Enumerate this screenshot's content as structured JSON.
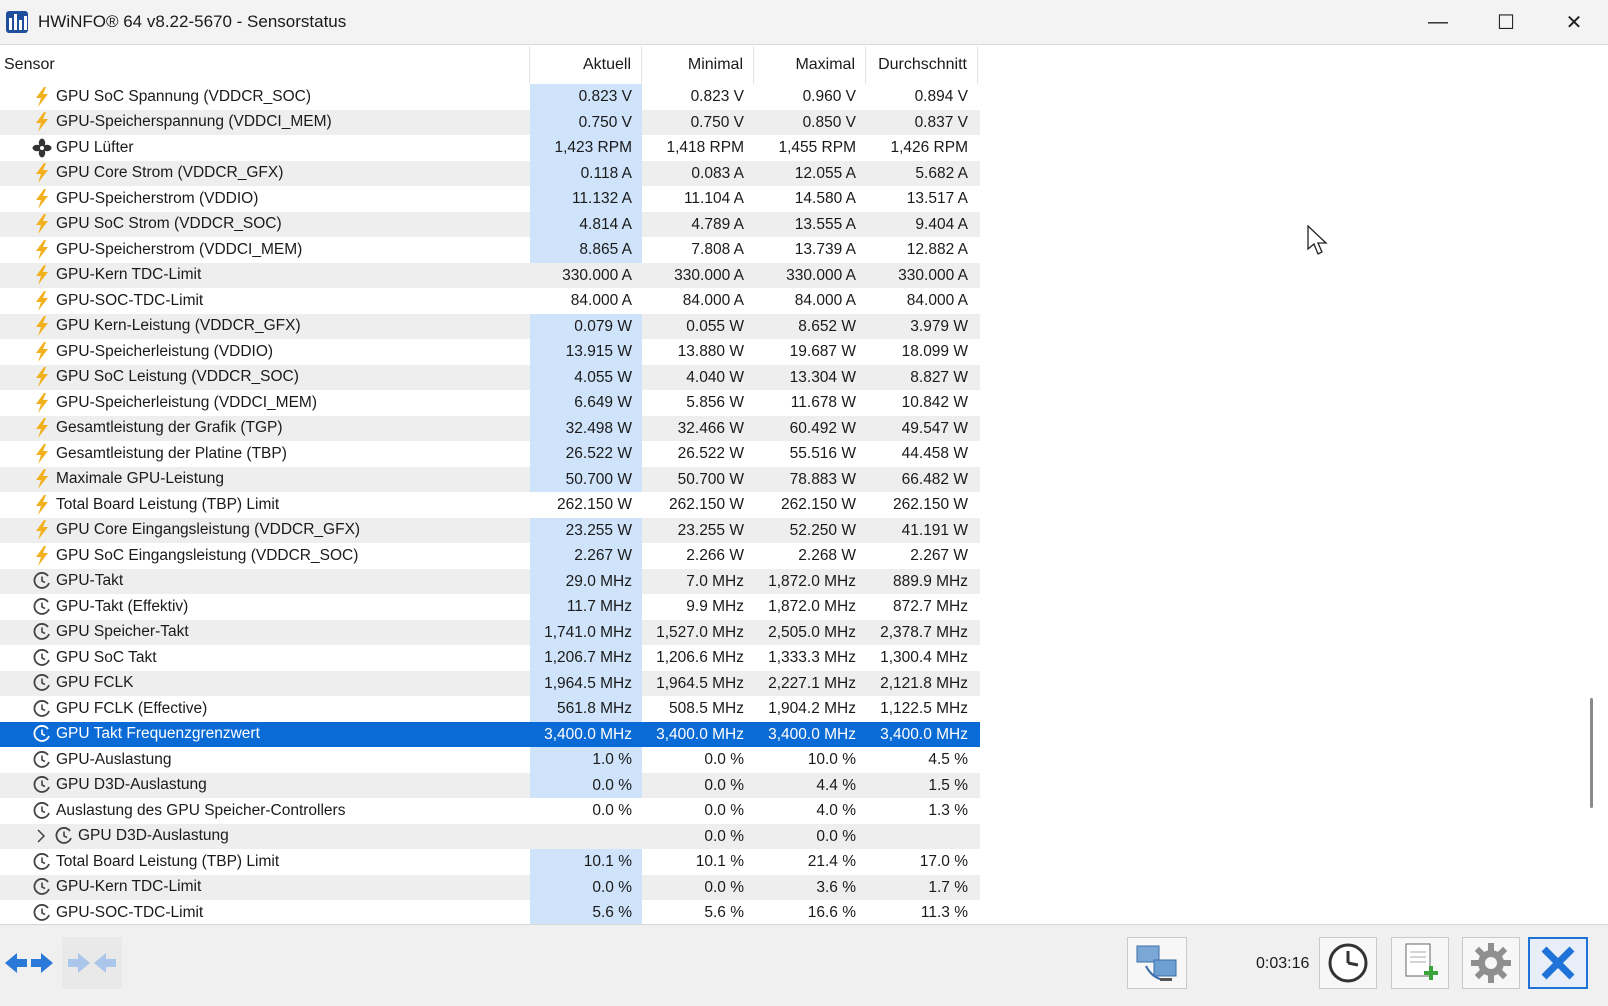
{
  "window": {
    "title": "HWiNFO® 64 v8.22-5670 - Sensorstatus",
    "minimize_glyph": "—",
    "maximize_glyph": "☐",
    "close_glyph": "✕"
  },
  "table": {
    "columns": [
      "Sensor",
      "Aktuell",
      "Minimal",
      "Maximal",
      "Durchschnitt"
    ],
    "selected_row_index": 25,
    "rows": [
      {
        "icon": "lightning-icon",
        "name": "GPU SoC Spannung (VDDCR_SOC)",
        "cur": "0.823 V",
        "min": "0.823 V",
        "max": "0.960 V",
        "avg": "0.894 V",
        "hl": true
      },
      {
        "icon": "lightning-icon",
        "name": "GPU-Speicherspannung (VDDCI_MEM)",
        "cur": "0.750 V",
        "min": "0.750 V",
        "max": "0.850 V",
        "avg": "0.837 V",
        "hl": true
      },
      {
        "icon": "fan-icon",
        "name": "GPU Lüfter",
        "cur": "1,423 RPM",
        "min": "1,418 RPM",
        "max": "1,455 RPM",
        "avg": "1,426 RPM",
        "hl": true
      },
      {
        "icon": "lightning-icon",
        "name": "GPU Core Strom (VDDCR_GFX)",
        "cur": "0.118 A",
        "min": "0.083 A",
        "max": "12.055 A",
        "avg": "5.682 A",
        "hl": true
      },
      {
        "icon": "lightning-icon",
        "name": "GPU-Speicherstrom (VDDIO)",
        "cur": "11.132 A",
        "min": "11.104 A",
        "max": "14.580 A",
        "avg": "13.517 A",
        "hl": true
      },
      {
        "icon": "lightning-icon",
        "name": "GPU SoC Strom (VDDCR_SOC)",
        "cur": "4.814 A",
        "min": "4.789 A",
        "max": "13.555 A",
        "avg": "9.404 A",
        "hl": true
      },
      {
        "icon": "lightning-icon",
        "name": "GPU-Speicherstrom (VDDCI_MEM)",
        "cur": "8.865 A",
        "min": "7.808 A",
        "max": "13.739 A",
        "avg": "12.882 A",
        "hl": true
      },
      {
        "icon": "lightning-icon",
        "name": "GPU-Kern TDC-Limit",
        "cur": "330.000 A",
        "min": "330.000 A",
        "max": "330.000 A",
        "avg": "330.000 A",
        "hl": false
      },
      {
        "icon": "lightning-icon",
        "name": "GPU-SOC-TDC-Limit",
        "cur": "84.000 A",
        "min": "84.000 A",
        "max": "84.000 A",
        "avg": "84.000 A",
        "hl": false
      },
      {
        "icon": "lightning-icon",
        "name": "GPU Kern-Leistung (VDDCR_GFX)",
        "cur": "0.079 W",
        "min": "0.055 W",
        "max": "8.652 W",
        "avg": "3.979 W",
        "hl": true
      },
      {
        "icon": "lightning-icon",
        "name": "GPU-Speicherleistung (VDDIO)",
        "cur": "13.915 W",
        "min": "13.880 W",
        "max": "19.687 W",
        "avg": "18.099 W",
        "hl": true
      },
      {
        "icon": "lightning-icon",
        "name": "GPU SoC Leistung (VDDCR_SOC)",
        "cur": "4.055 W",
        "min": "4.040 W",
        "max": "13.304 W",
        "avg": "8.827 W",
        "hl": true
      },
      {
        "icon": "lightning-icon",
        "name": "GPU-Speicherleistung (VDDCI_MEM)",
        "cur": "6.649 W",
        "min": "5.856 W",
        "max": "11.678 W",
        "avg": "10.842 W",
        "hl": true
      },
      {
        "icon": "lightning-icon",
        "name": "Gesamtleistung der Grafik (TGP)",
        "cur": "32.498 W",
        "min": "32.466 W",
        "max": "60.492 W",
        "avg": "49.547 W",
        "hl": true
      },
      {
        "icon": "lightning-icon",
        "name": "Gesamtleistung der Platine (TBP)",
        "cur": "26.522 W",
        "min": "26.522 W",
        "max": "55.516 W",
        "avg": "44.458 W",
        "hl": true
      },
      {
        "icon": "lightning-icon",
        "name": "Maximale GPU-Leistung",
        "cur": "50.700 W",
        "min": "50.700 W",
        "max": "78.883 W",
        "avg": "66.482 W",
        "hl": true
      },
      {
        "icon": "lightning-icon",
        "name": "Total Board Leistung (TBP) Limit",
        "cur": "262.150 W",
        "min": "262.150 W",
        "max": "262.150 W",
        "avg": "262.150 W",
        "hl": false
      },
      {
        "icon": "lightning-icon",
        "name": "GPU Core Eingangsleistung (VDDCR_GFX)",
        "cur": "23.255 W",
        "min": "23.255 W",
        "max": "52.250 W",
        "avg": "41.191 W",
        "hl": true
      },
      {
        "icon": "lightning-icon",
        "name": "GPU SoC Eingangsleistung (VDDCR_SOC)",
        "cur": "2.267 W",
        "min": "2.266 W",
        "max": "2.268 W",
        "avg": "2.267 W",
        "hl": true
      },
      {
        "icon": "clock-icon",
        "name": "GPU-Takt",
        "cur": "29.0 MHz",
        "min": "7.0 MHz",
        "max": "1,872.0 MHz",
        "avg": "889.9 MHz",
        "hl": true
      },
      {
        "icon": "clock-icon",
        "name": "GPU-Takt (Effektiv)",
        "cur": "11.7 MHz",
        "min": "9.9 MHz",
        "max": "1,872.0 MHz",
        "avg": "872.7 MHz",
        "hl": true
      },
      {
        "icon": "clock-icon",
        "name": "GPU Speicher-Takt",
        "cur": "1,741.0 MHz",
        "min": "1,527.0 MHz",
        "max": "2,505.0 MHz",
        "avg": "2,378.7 MHz",
        "hl": true
      },
      {
        "icon": "clock-icon",
        "name": "GPU SoC Takt",
        "cur": "1,206.7 MHz",
        "min": "1,206.6 MHz",
        "max": "1,333.3 MHz",
        "avg": "1,300.4 MHz",
        "hl": true
      },
      {
        "icon": "clock-icon",
        "name": "GPU FCLK",
        "cur": "1,964.5 MHz",
        "min": "1,964.5 MHz",
        "max": "2,227.1 MHz",
        "avg": "2,121.8 MHz",
        "hl": true
      },
      {
        "icon": "clock-icon",
        "name": "GPU FCLK (Effective)",
        "cur": "561.8 MHz",
        "min": "508.5 MHz",
        "max": "1,904.2 MHz",
        "avg": "1,122.5 MHz",
        "hl": true
      },
      {
        "icon": "clock-icon",
        "name": "GPU Takt Frequenzgrenzwert",
        "cur": "3,400.0 MHz",
        "min": "3,400.0 MHz",
        "max": "3,400.0 MHz",
        "avg": "3,400.0 MHz",
        "hl": false
      },
      {
        "icon": "clock-icon",
        "name": "GPU-Auslastung",
        "cur": "1.0 %",
        "min": "0.0 %",
        "max": "10.0 %",
        "avg": "4.5 %",
        "hl": true
      },
      {
        "icon": "clock-icon",
        "name": "GPU D3D-Auslastung",
        "cur": "0.0 %",
        "min": "0.0 %",
        "max": "4.4 %",
        "avg": "1.5 %",
        "hl": true
      },
      {
        "icon": "clock-icon",
        "name": "Auslastung des GPU Speicher-Controllers",
        "cur": "0.0 %",
        "min": "0.0 %",
        "max": "4.0 %",
        "avg": "1.3 %",
        "hl": false
      },
      {
        "icon": "clock-icon",
        "name": "GPU D3D-Auslastung",
        "cur": "",
        "min": "0.0 %",
        "max": "0.0 %",
        "avg": "",
        "hl": false,
        "expandable": true
      },
      {
        "icon": "clock-icon",
        "name": "Total Board Leistung (TBP) Limit",
        "cur": "10.1 %",
        "min": "10.1 %",
        "max": "21.4 %",
        "avg": "17.0 %",
        "hl": true
      },
      {
        "icon": "clock-icon",
        "name": "GPU-Kern TDC-Limit",
        "cur": "0.0 %",
        "min": "0.0 %",
        "max": "3.6 %",
        "avg": "1.7 %",
        "hl": true
      },
      {
        "icon": "clock-icon",
        "name": "GPU-SOC-TDC-Limit",
        "cur": "5.6 %",
        "min": "5.6 %",
        "max": "16.6 %",
        "avg": "11.3 %",
        "hl": true
      }
    ]
  },
  "bottombar": {
    "elapsed_time": "0:03:16"
  },
  "colors": {
    "selection": "#0b6bd6",
    "current_highlight": "#cfe3fa",
    "lightning": "#f2b01e",
    "accent_close": "#1e72d8"
  }
}
